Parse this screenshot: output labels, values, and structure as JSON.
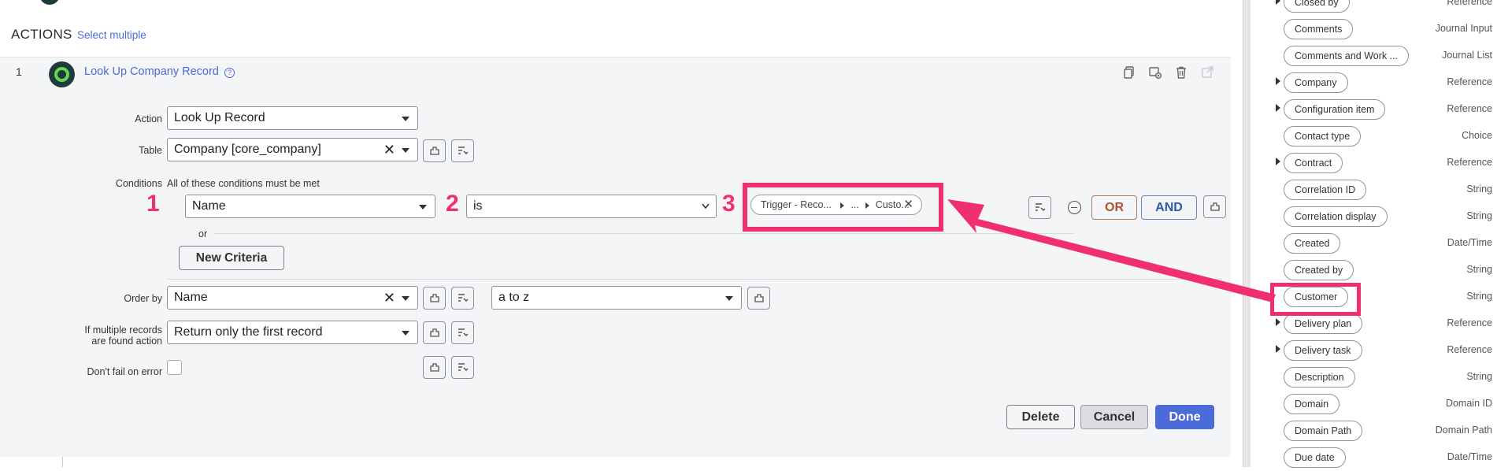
{
  "header": {
    "title": "ACTIONS",
    "select_multiple": "Select multiple"
  },
  "action": {
    "number": "1",
    "title": "Look Up Company Record",
    "help_icon": "help-circle-icon",
    "toolbar_icons": [
      "copy-icon",
      "duplicate-icon",
      "trash-icon",
      "open-external-icon"
    ]
  },
  "form": {
    "action_label": "Action",
    "action_value": "Look Up Record",
    "table_label": "Table",
    "table_value": "Company [core_company]",
    "conditions_label": "Conditions",
    "conditions_hint": "All of these conditions must be met",
    "condition": {
      "field": "Name",
      "operator": "is",
      "value_segments": [
        "Trigger - Reco...",
        "...",
        "Custo..."
      ]
    },
    "or_label": "or",
    "new_criteria": "New Criteria",
    "or_button": "OR",
    "and_button": "AND",
    "order_by_label": "Order by",
    "order_by_value": "Name",
    "order_dir_value": "a to z",
    "multiple_label_line1": "If multiple records",
    "multiple_label_line2": "are found action",
    "multiple_value": "Return only the first record",
    "dont_fail_label": "Don't fail on error",
    "dont_fail_checked": false
  },
  "footer": {
    "delete": "Delete",
    "cancel": "Cancel",
    "done": "Done"
  },
  "annotations": {
    "n1": "1",
    "n2": "2",
    "n3": "3",
    "color": "#f0306e"
  },
  "data_panel": {
    "fields": [
      {
        "name": "Closed by",
        "type": "Reference",
        "expandable": true
      },
      {
        "name": "Comments",
        "type": "Journal Input",
        "expandable": false
      },
      {
        "name": "Comments and Work ...",
        "type": "Journal List",
        "expandable": false
      },
      {
        "name": "Company",
        "type": "Reference",
        "expandable": true
      },
      {
        "name": "Configuration item",
        "type": "Reference",
        "expandable": true
      },
      {
        "name": "Contact type",
        "type": "Choice",
        "expandable": false
      },
      {
        "name": "Contract",
        "type": "Reference",
        "expandable": true
      },
      {
        "name": "Correlation ID",
        "type": "String",
        "expandable": false
      },
      {
        "name": "Correlation display",
        "type": "String",
        "expandable": false
      },
      {
        "name": "Created",
        "type": "Date/Time",
        "expandable": false
      },
      {
        "name": "Created by",
        "type": "String",
        "expandable": false
      },
      {
        "name": "Customer",
        "type": "String",
        "expandable": false
      },
      {
        "name": "Delivery plan",
        "type": "Reference",
        "expandable": true
      },
      {
        "name": "Delivery task",
        "type": "Reference",
        "expandable": true
      },
      {
        "name": "Description",
        "type": "String",
        "expandable": false
      },
      {
        "name": "Domain",
        "type": "Domain ID",
        "expandable": false
      },
      {
        "name": "Domain Path",
        "type": "Domain Path",
        "expandable": false
      },
      {
        "name": "Due date",
        "type": "Date/Time",
        "expandable": false
      }
    ]
  },
  "colors": {
    "accent_blue": "#4a6bd8",
    "primary_button": "#4a6bd8",
    "annotation_pink": "#f0306e",
    "or_text": "#b0532a",
    "and_text": "#2f5aa8"
  }
}
